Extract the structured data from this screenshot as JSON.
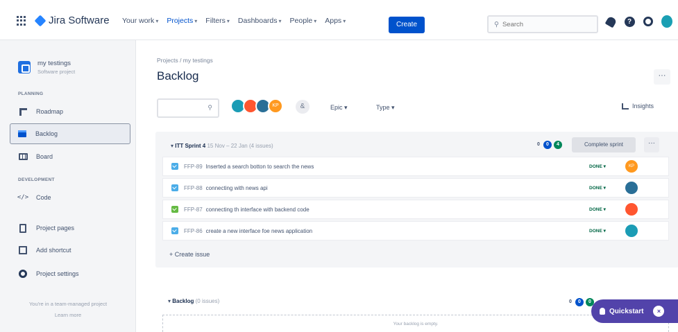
{
  "topnav": {
    "product_name": "Jira Software",
    "menu": [
      {
        "label": "Your work",
        "chevron": "▾"
      },
      {
        "label": "Projects",
        "chevron": "▾"
      },
      {
        "label": "Filters",
        "chevron": "▾"
      },
      {
        "label": "Dashboards",
        "chevron": "▾"
      },
      {
        "label": "People",
        "chevron": "▾"
      },
      {
        "label": "Apps",
        "chevron": "▾"
      }
    ],
    "create_label": "Create",
    "search_placeholder": "Search",
    "search_icon": "⚲",
    "help_glyph": "?",
    "icons": [
      "grid-icon",
      "bell-icon",
      "help-icon",
      "gear-icon",
      "profile-avatar"
    ]
  },
  "sidebar": {
    "project_name": "my testings",
    "project_type": "Software project",
    "section_planning": "PLANNING",
    "section_development": "DEVELOPMENT",
    "items": [
      {
        "label": "Roadmap"
      },
      {
        "label": "Backlog"
      },
      {
        "label": "Board"
      },
      {
        "label": "Code",
        "icon_glyph": "</>"
      },
      {
        "label": "Project pages"
      },
      {
        "label": "Add shortcut"
      },
      {
        "label": "Project settings"
      }
    ],
    "footer_text": "You're in a team-managed project",
    "footer_link": "Learn more"
  },
  "main": {
    "breadcrumb": "Projects / my testings",
    "title": "Backlog",
    "more_glyph": "···",
    "search_icon": "⚲",
    "avatars": [
      {
        "initials": "",
        "color": "#1b9cb5"
      },
      {
        "initials": "",
        "color": "#ff5630"
      },
      {
        "initials": "",
        "color": "#2a6f97"
      },
      {
        "initials": "KP",
        "color": "#ff991f"
      }
    ],
    "add_people_glyph": "&",
    "epic_label": "Epic",
    "type_label": "Type",
    "dropdown_chevron": "▾",
    "insights_label": "Insights"
  },
  "sprint": {
    "toggle": "▾",
    "name": "ITT Sprint 4",
    "dates": "15 Nov – 22 Jan (4 issues)",
    "counts": [
      "0",
      "0",
      "4"
    ],
    "complete_label": "Complete sprint",
    "more_glyph": "···",
    "issues": [
      {
        "key": "FFP-89",
        "summary": "Inserted a search botton to search the news",
        "status": "DONE ▾",
        "type": "task",
        "avatar_initials": "KP",
        "avatar_color": "#ff991f"
      },
      {
        "key": "FFP-88",
        "summary": "connecting with news api",
        "status": "DONE ▾",
        "type": "task",
        "avatar_initials": "",
        "avatar_color": "#2a6f97"
      },
      {
        "key": "FFP-87",
        "summary": "connecting th interface with backend code",
        "status": "DONE ▾",
        "type": "story",
        "avatar_initials": "",
        "avatar_color": "#ff5630"
      },
      {
        "key": "FFP-86",
        "summary": "create a new interface foe news application",
        "status": "DONE ▾",
        "type": "task",
        "avatar_initials": "",
        "avatar_color": "#1b9cb5"
      }
    ],
    "create_issue_label": "+ Create issue"
  },
  "backlog": {
    "toggle": "▾",
    "name": "Backlog",
    "issue_count": "(0 issues)",
    "counts": [
      "0",
      "0",
      "0"
    ],
    "empty_text": "Your backlog is empty."
  },
  "quickstart": {
    "label": "Quickstart",
    "close_glyph": "×"
  }
}
